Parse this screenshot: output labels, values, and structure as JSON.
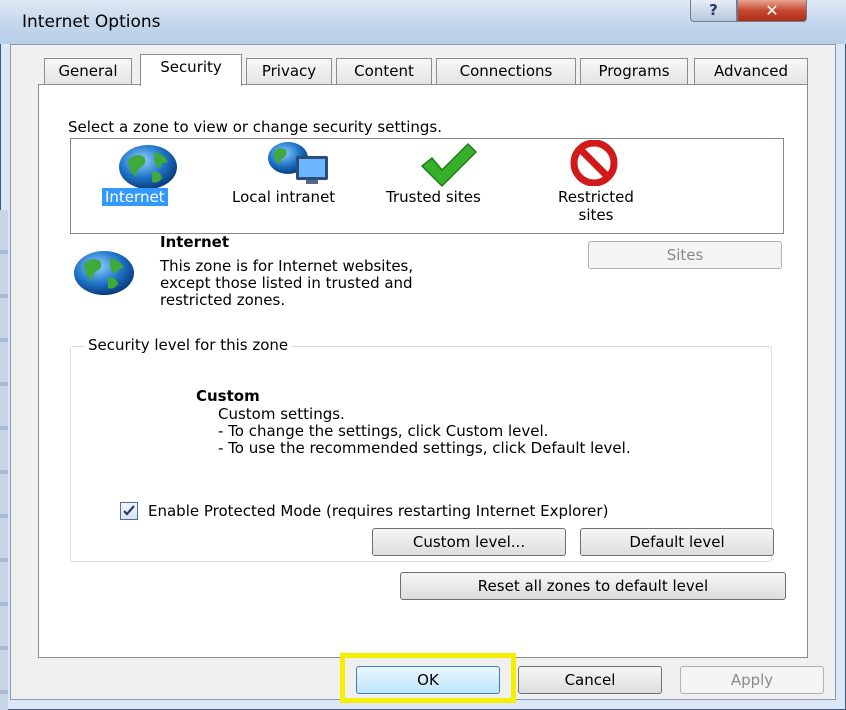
{
  "window": {
    "title": "Internet Options",
    "help_glyph": "?",
    "close_glyph": "✕"
  },
  "tabs": [
    {
      "label": "General"
    },
    {
      "label": "Security"
    },
    {
      "label": "Privacy"
    },
    {
      "label": "Content"
    },
    {
      "label": "Connections"
    },
    {
      "label": "Programs"
    },
    {
      "label": "Advanced"
    }
  ],
  "zones": {
    "prompt": "Select a zone to view or change security settings.",
    "items": [
      {
        "label": "Internet",
        "icon": "globe-icon",
        "selected": true
      },
      {
        "label": "Local intranet",
        "icon": "intranet-icon"
      },
      {
        "label": "Trusted sites",
        "icon": "checkmark-icon"
      },
      {
        "label_line1": "Restricted",
        "label_line2": "sites",
        "icon": "blocked-icon"
      }
    ]
  },
  "zone_info": {
    "name": "Internet",
    "desc_line1": "This zone is for Internet websites,",
    "desc_line2": "except those listed in trusted and",
    "desc_line3": "restricted zones.",
    "sites_button": "Sites"
  },
  "security_level": {
    "group_title": "Security level for this zone",
    "level_name": "Custom",
    "line1": "Custom settings.",
    "line2": "- To change the settings, click Custom level.",
    "line3": "- To use the recommended settings, click Default level.",
    "protected_mode_label": "Enable Protected Mode (requires restarting Internet Explorer)",
    "protected_mode_checked": true,
    "custom_level_button": "Custom level...",
    "default_level_button": "Default level"
  },
  "reset_button": "Reset all zones to default level",
  "footer": {
    "ok": "OK",
    "cancel": "Cancel",
    "apply": "Apply"
  },
  "colors": {
    "selection": "#3399ff",
    "highlight": "#f5ee00"
  }
}
